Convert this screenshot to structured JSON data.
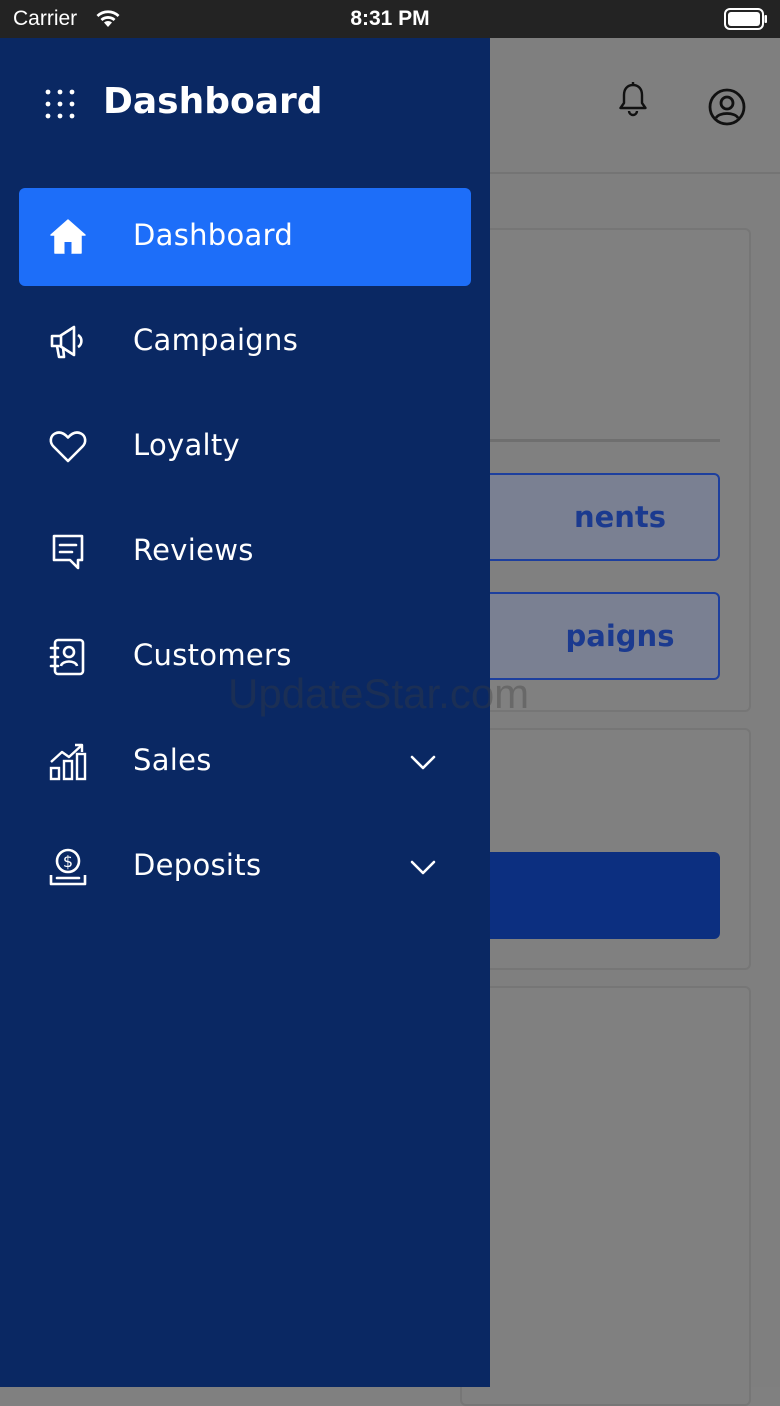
{
  "status_bar": {
    "carrier": "Carrier",
    "time": "8:31 PM"
  },
  "drawer": {
    "title": "Dashboard",
    "items": [
      {
        "label": "Dashboard",
        "icon": "home-icon",
        "active": true
      },
      {
        "label": "Campaigns",
        "icon": "megaphone-icon"
      },
      {
        "label": "Loyalty",
        "icon": "heart-icon"
      },
      {
        "label": "Reviews",
        "icon": "chat-icon"
      },
      {
        "label": "Customers",
        "icon": "contacts-icon"
      },
      {
        "label": "Sales",
        "icon": "chart-icon",
        "expandable": true
      },
      {
        "label": "Deposits",
        "icon": "money-icon",
        "expandable": true
      }
    ]
  },
  "background": {
    "button_1_partial": "nents",
    "button_2_partial": "paigns"
  },
  "watermark": "UpdateStar.com",
  "colors": {
    "drawer_bg": "#0a2863",
    "active_item": "#1d6ef9",
    "overlay": "#7f7f7f"
  }
}
